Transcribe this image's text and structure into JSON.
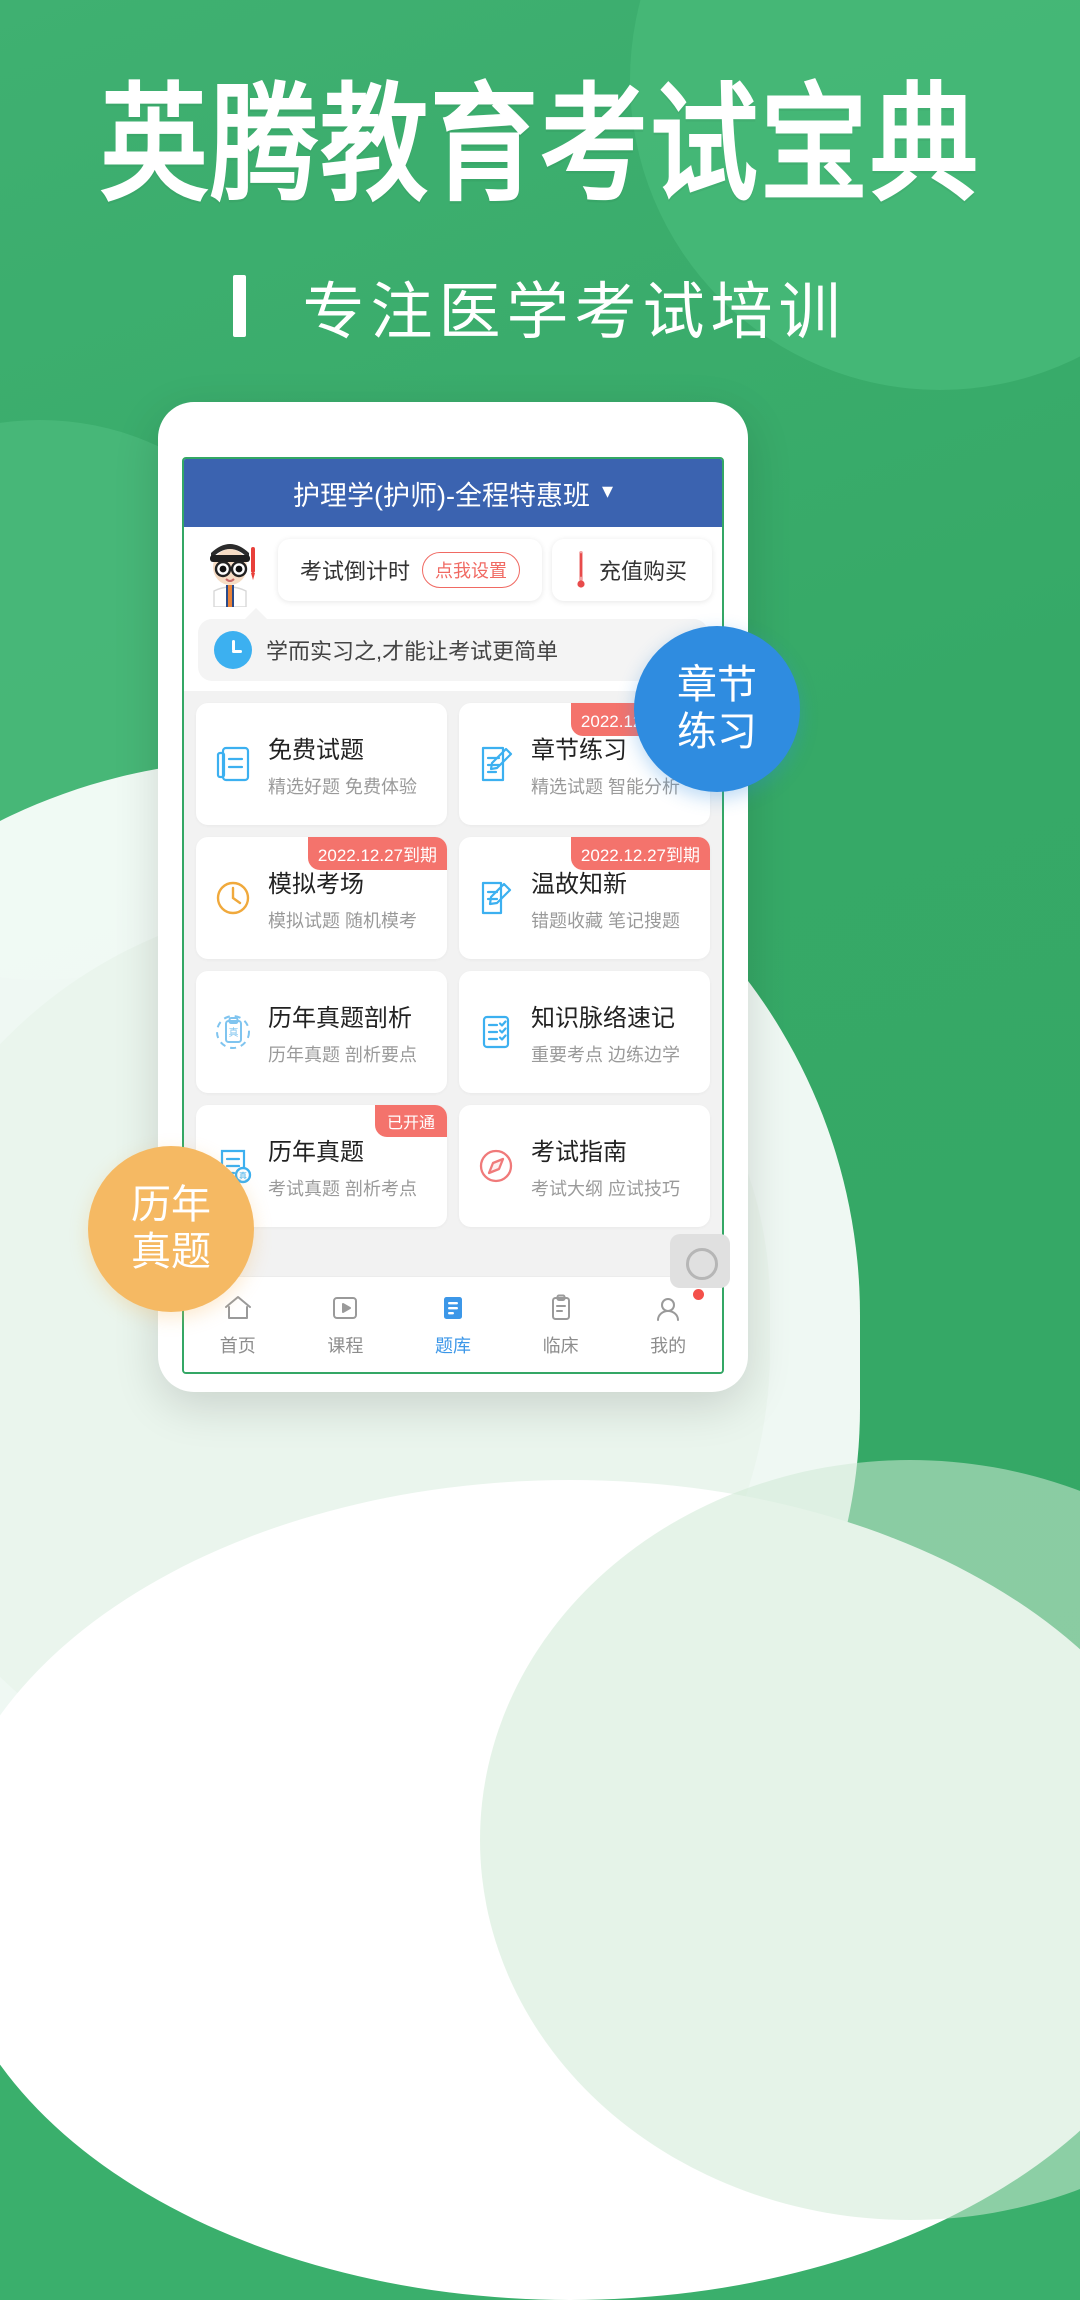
{
  "hero": {
    "title": "英腾教育考试宝典",
    "subtitle": "专注医学考试培训"
  },
  "colors": {
    "brand_green": "#34a765",
    "header_blue": "#3b63b0",
    "accent_red": "#f4736c",
    "accent_blue": "#3c97e8",
    "accent_orange": "#f5b963"
  },
  "app": {
    "header": {
      "title": "护理学(护师)-全程特惠班",
      "chevron": "chevron-down-icon"
    },
    "countdown": {
      "label": "考试倒计时",
      "action_badge": "点我设置"
    },
    "buy": {
      "label": "充值购买"
    },
    "notice": {
      "icon": "clock-icon",
      "text": "学而实习之,才能让考试更简单"
    },
    "grid": [
      {
        "title": "免费试题",
        "sub": "精选好题 免费体验",
        "tag": "",
        "icon": "document-lines-icon",
        "icon_color": "#3cb0f0"
      },
      {
        "title": "章节练习",
        "sub": "精选试题 智能分析",
        "tag": "2022.12.27到期",
        "icon": "note-pencil-icon",
        "icon_color": "#3cb0f0"
      },
      {
        "title": "模拟考场",
        "sub": "模拟试题 随机模考",
        "tag": "2022.12.27到期",
        "icon": "clock-outline-icon",
        "icon_color": "#f0a93c"
      },
      {
        "title": "温故知新",
        "sub": "错题收藏 笔记搜题",
        "tag": "2022.12.27到期",
        "icon": "note-edit-icon",
        "icon_color": "#3cb0f0"
      },
      {
        "title": "历年真题剖析",
        "sub": "历年真题 剖析要点",
        "tag": "",
        "icon": "clipboard-circle-icon",
        "icon_color": "#7fc4ef"
      },
      {
        "title": "知识脉络速记",
        "sub": "重要考点 边练边学",
        "tag": "",
        "icon": "checklist-icon",
        "icon_color": "#3cb0f0"
      },
      {
        "title": "历年真题",
        "sub": "考试真题 剖析考点",
        "tag": "已开通",
        "icon": "paper-real-icon",
        "icon_color": "#3cb0f0"
      },
      {
        "title": "考试指南",
        "sub": "考试大纲 应试技巧",
        "tag": "",
        "icon": "compass-icon",
        "icon_color": "#f07a7a"
      }
    ],
    "tabs": [
      {
        "label": "首页",
        "icon": "home-icon",
        "active": false,
        "badge": false
      },
      {
        "label": "课程",
        "icon": "play-box-icon",
        "active": false,
        "badge": false
      },
      {
        "label": "题库",
        "icon": "question-bank-icon",
        "active": true,
        "badge": false
      },
      {
        "label": "临床",
        "icon": "clinic-board-icon",
        "active": false,
        "badge": false
      },
      {
        "label": "我的",
        "icon": "user-circle-icon",
        "active": false,
        "badge": true
      }
    ]
  },
  "bubbles": [
    {
      "line1": "章节",
      "line2": "练习"
    },
    {
      "line1": "历年",
      "line2": "真题"
    }
  ]
}
